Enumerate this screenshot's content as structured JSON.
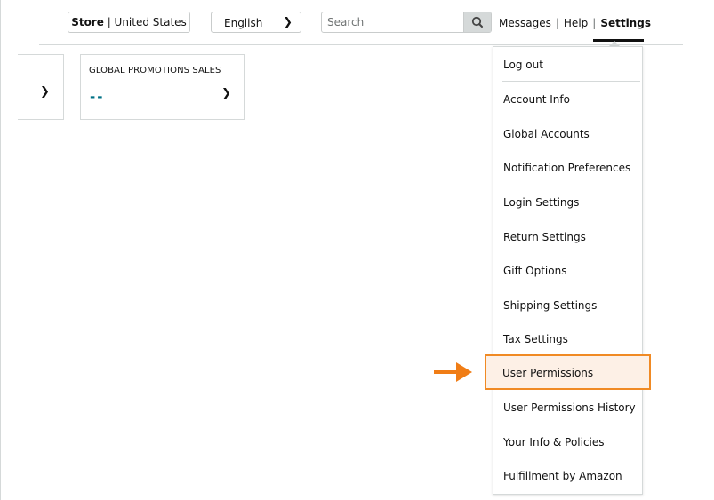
{
  "header": {
    "store": {
      "bold": "Store",
      "separator": " | ",
      "region": "United States"
    },
    "language": {
      "selected": "English"
    },
    "search": {
      "placeholder": "Search"
    },
    "links": {
      "messages": "Messages",
      "help": "Help",
      "settings": "Settings"
    }
  },
  "cards": {
    "promotions": {
      "title": "GLOBAL PROMOTIONS SALES",
      "value": "--"
    }
  },
  "settings_menu": {
    "items": [
      "Log out",
      "Account Info",
      "Global Accounts",
      "Notification Preferences",
      "Login Settings",
      "Return Settings",
      "Gift Options",
      "Shipping Settings",
      "Tax Settings",
      "User Permissions",
      "User Permissions History",
      "Your Info & Policies",
      "Fulfillment by Amazon"
    ],
    "highlighted_index": 9
  },
  "colors": {
    "highlight_border": "#f08a24",
    "highlight_fill": "#fdf0e6",
    "arrow": "#f07d16",
    "dash_value": "#007185"
  },
  "icons": {
    "search": "search-icon",
    "chevron": "chevron-down-icon",
    "arrow": "arrow-right-icon"
  }
}
